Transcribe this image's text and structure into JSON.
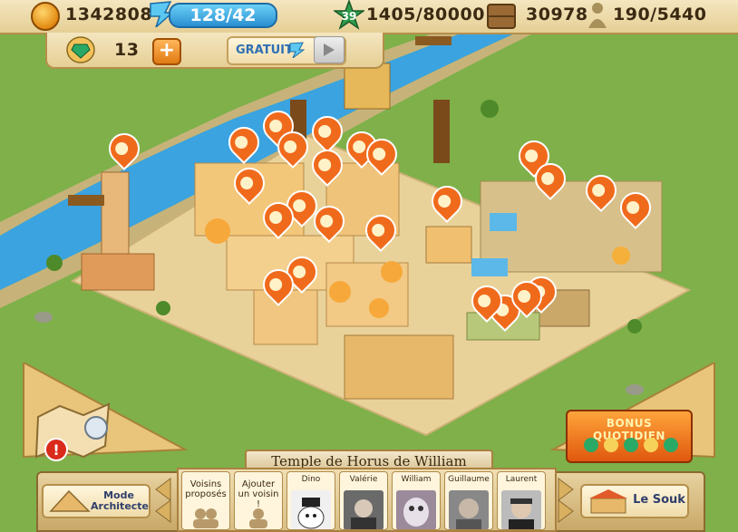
{
  "hud": {
    "coins": "1342808",
    "energy": "128/42",
    "level": "39",
    "xp": "1405/80000",
    "goods": "30978",
    "population": "190/5440",
    "gems": "13",
    "gems_add": "+",
    "free_label": "GRATUIT"
  },
  "city_title": "Temple de Horus de William",
  "bottom": {
    "architect_mode": "Mode Architecte",
    "proposed_neighbors": "Voisins proposés",
    "add_neighbor": "Ajouter un voisin !",
    "souk": "Le Souk",
    "daily_bonus": "BONUS QUOTIDIEN"
  },
  "friends": [
    {
      "name": "Dino"
    },
    {
      "name": "Valérie"
    },
    {
      "name": "William"
    },
    {
      "name": "Guillaume"
    },
    {
      "name": "Laurent"
    }
  ],
  "icons": [
    "coin-icon",
    "energy-icon",
    "star-level-icon",
    "crate-icon",
    "population-icon",
    "gem-icon",
    "plus-icon",
    "play-icon",
    "map-icon",
    "alert-icon",
    "arrow-left-icon",
    "arrow-right-icon"
  ],
  "colors": {
    "accent": "#f06a1c",
    "river": "#3aa3e0",
    "sand": "#e9d29a",
    "grass": "#7fb04a"
  }
}
